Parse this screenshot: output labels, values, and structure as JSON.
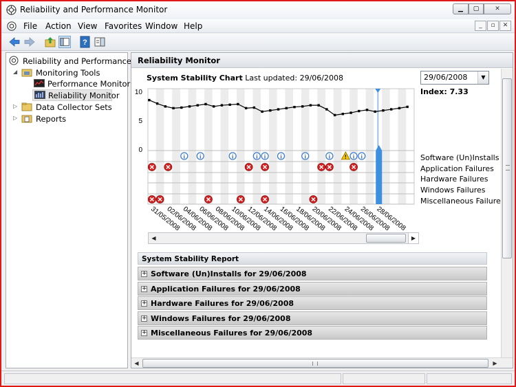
{
  "window": {
    "title": "Reliability and Performance Monitor"
  },
  "menu": {
    "items": [
      "File",
      "Action",
      "View",
      "Favorites",
      "Window",
      "Help"
    ]
  },
  "tree": {
    "root": "Reliability and Performance",
    "monitoring_tools": "Monitoring Tools",
    "performance_monitor": "Performance Monitor",
    "reliability_monitor": "Reliability Monitor",
    "data_collector_sets": "Data Collector Sets",
    "reports": "Reports"
  },
  "panel": {
    "header": "Reliability Monitor",
    "chart_title_bold": "System Stability Chart",
    "last_updated": "Last updated: 29/06/2008",
    "selected_date": "29/06/2008",
    "index_label": "Index: 7.33"
  },
  "chart_data": {
    "type": "line",
    "title": "System Stability Chart",
    "ylim": [
      0,
      10
    ],
    "y_ticks": [
      "10",
      "5",
      "0"
    ],
    "x_labels": [
      "31/05/2008",
      "02/06/2008",
      "04/06/2008",
      "06/06/2008",
      "08/06/2008",
      "10/06/2008",
      "12/06/2008",
      "14/06/2008",
      "16/06/2008",
      "18/06/2008",
      "20/06/2008",
      "22/06/2008",
      "24/06/2008",
      "26/06/2008",
      "28/06/2008"
    ],
    "series": [
      {
        "values": [
          8.5,
          7.9,
          7.4,
          7.1,
          7.2,
          7.4,
          7.6,
          7.8,
          7.4,
          7.6,
          7.7,
          7.8,
          7.1,
          7.2,
          6.5,
          6.7,
          6.9,
          7.1,
          7.3,
          7.4,
          7.6,
          7.6,
          6.9,
          5.9,
          6.1,
          6.3,
          6.6,
          6.8,
          6.5,
          6.7,
          6.9,
          7.1,
          7.33
        ]
      }
    ],
    "categories": [
      "Software (Un)Installs",
      "Application Failures",
      "Hardware Failures",
      "Windows Failures",
      "Miscellaneous Failures"
    ],
    "events": {
      "software_info": [
        5,
        7,
        11,
        14,
        15,
        17,
        20,
        23,
        26,
        27
      ],
      "software_warning": [
        26
      ],
      "application_failures": [
        1,
        3,
        13,
        15,
        22,
        23,
        26
      ],
      "hardware_failures": [],
      "windows_failures": [],
      "misc_failures": [
        1,
        2,
        8,
        12,
        15,
        21
      ]
    },
    "selected_day": 29
  },
  "report": {
    "header": "System Stability Report",
    "rows": [
      "Software (Un)Installs for 29/06/2008",
      "Application Failures for 29/06/2008",
      "Hardware Failures for 29/06/2008",
      "Windows Failures for 29/06/2008",
      "Miscellaneous Failures for 29/06/2008"
    ]
  }
}
